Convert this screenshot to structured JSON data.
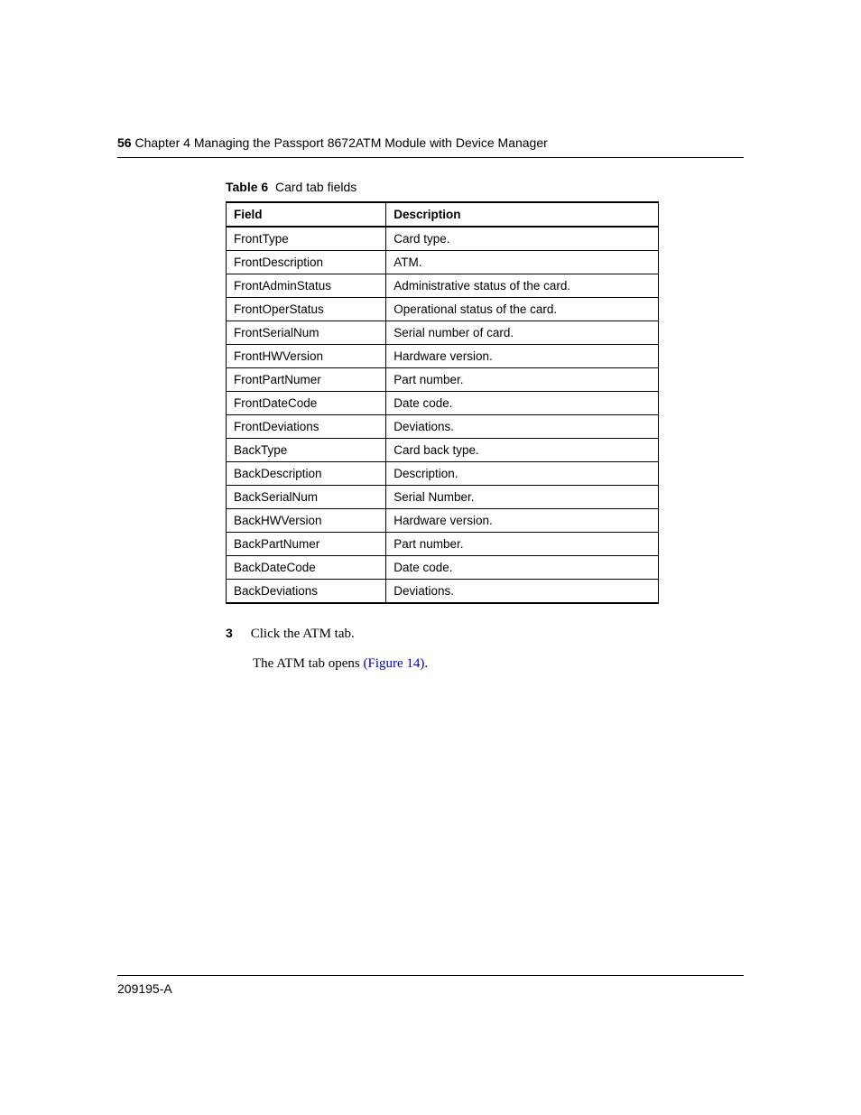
{
  "header": {
    "page_number": "56",
    "chapter": "Chapter 4  Managing the Passport 8672ATM Module with Device Manager"
  },
  "table": {
    "label": "Table 6",
    "caption": "Card tab fields",
    "headers": {
      "field": "Field",
      "description": "Description"
    },
    "rows": [
      {
        "field": "FrontType",
        "description": "Card type."
      },
      {
        "field": "FrontDescription",
        "description": "ATM."
      },
      {
        "field": "FrontAdminStatus",
        "description": "Administrative status of the card."
      },
      {
        "field": "FrontOperStatus",
        "description": "Operational status of the card."
      },
      {
        "field": "FrontSerialNum",
        "description": "Serial number of card."
      },
      {
        "field": "FrontHWVersion",
        "description": "Hardware version."
      },
      {
        "field": "FrontPartNumer",
        "description": "Part number."
      },
      {
        "field": "FrontDateCode",
        "description": "Date code."
      },
      {
        "field": "FrontDeviations",
        "description": "Deviations."
      },
      {
        "field": "BackType",
        "description": "Card back type."
      },
      {
        "field": "BackDescription",
        "description": "Description."
      },
      {
        "field": "BackSerialNum",
        "description": "Serial Number."
      },
      {
        "field": "BackHWVersion",
        "description": "Hardware version."
      },
      {
        "field": "BackPartNumer",
        "description": "Part number."
      },
      {
        "field": "BackDateCode",
        "description": "Date code."
      },
      {
        "field": "BackDeviations",
        "description": "Deviations."
      }
    ]
  },
  "step": {
    "number": "3",
    "text": "Click the ATM tab."
  },
  "body": {
    "prefix": "The ATM tab opens ",
    "link": "(Figure 14)",
    "suffix": "."
  },
  "footer": {
    "doc_id": "209195-A"
  }
}
